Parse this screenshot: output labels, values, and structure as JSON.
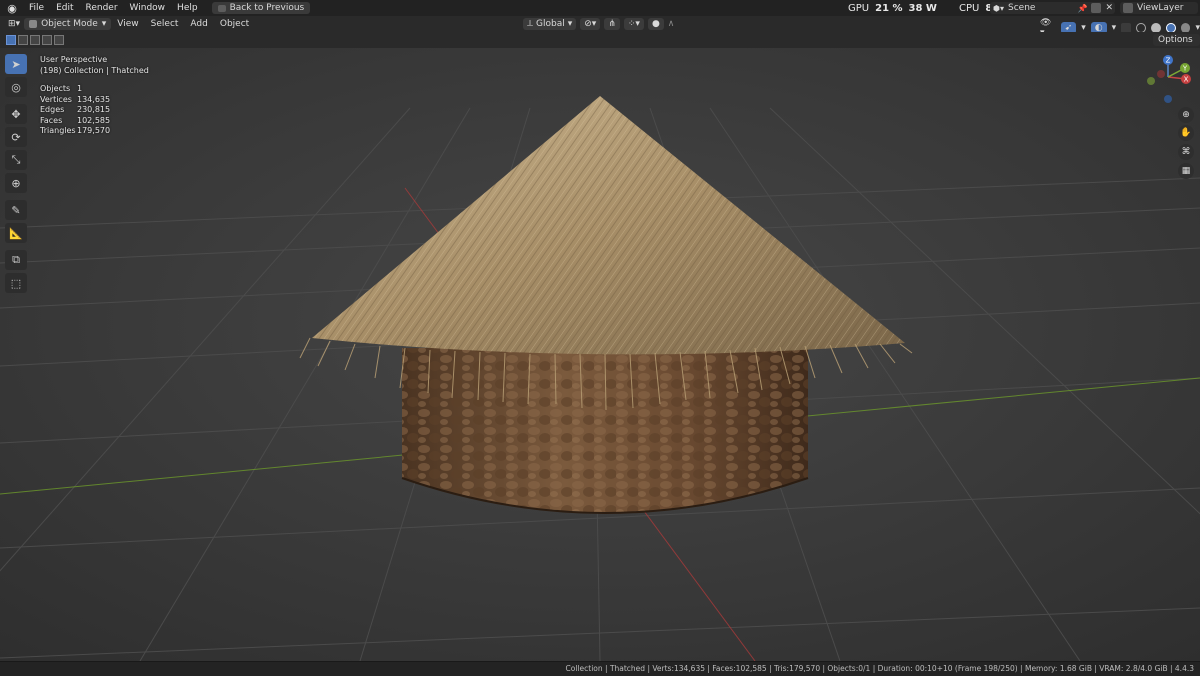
{
  "app": {
    "logo_icon": "blender-icon"
  },
  "menu": {
    "file": "File",
    "edit": "Edit",
    "render": "Render",
    "window": "Window",
    "help": "Help",
    "back": "Back to Previous"
  },
  "perf": {
    "gpu_label": "GPU",
    "gpu_pct": "21 %",
    "gpu_watts": "38 W",
    "cpu_label": "CPU",
    "cpu_pct": "8 %"
  },
  "scene": {
    "label": "Scene",
    "viewlayer": "ViewLayer"
  },
  "header": {
    "mode": "Object Mode",
    "view": "View",
    "select": "Select",
    "add": "Add",
    "object": "Object",
    "orientation": "Global"
  },
  "options_label": "Options",
  "overlay": {
    "perspective": "User Perspective",
    "collection": "(198) Collection | Thatched",
    "stats": [
      {
        "label": "Objects",
        "value": "1"
      },
      {
        "label": "Vertices",
        "value": "134,635"
      },
      {
        "label": "Edges",
        "value": "230,815"
      },
      {
        "label": "Faces",
        "value": "102,585"
      },
      {
        "label": "Triangles",
        "value": "179,570"
      }
    ]
  },
  "gizmo": {
    "x": "X",
    "y": "Y",
    "z": "Z"
  },
  "status": {
    "text": "Collection | Thatched | Verts:134,635 | Faces:102,585 | Tris:179,570 | Objects:0/1 | Duration: 00:10+10 (Frame 198/250) | Memory: 1.68 GiB | VRAM: 2.8/4.0 GiB | 4.4.3"
  },
  "colors": {
    "viewport_bg": "#3e3e3e",
    "active_blue": "#4772b3",
    "axis_red": "#a83a3a",
    "axis_green": "#6d9a2b"
  }
}
